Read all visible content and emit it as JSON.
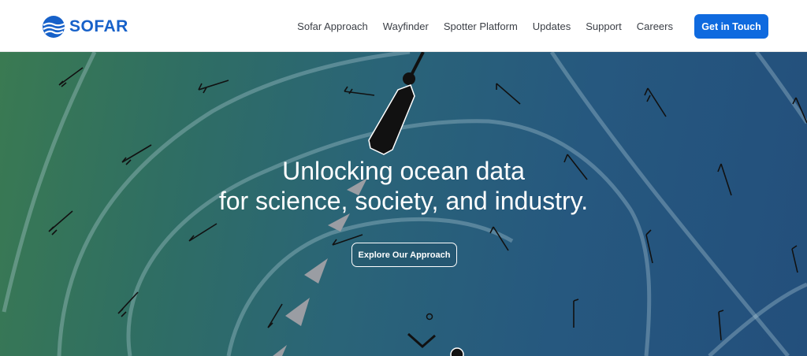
{
  "brand": {
    "name": "SOFAR",
    "color": "#1761c9"
  },
  "nav": {
    "items": [
      {
        "label": "Sofar Approach"
      },
      {
        "label": "Wayfinder"
      },
      {
        "label": "Spotter Platform"
      },
      {
        "label": "Updates"
      },
      {
        "label": "Support"
      },
      {
        "label": "Careers"
      }
    ],
    "cta_label": "Get in Touch",
    "cta_color": "#0f6adf"
  },
  "hero": {
    "headline_line1": "Unlocking ocean data",
    "headline_line2": "for science, society, and industry.",
    "button_label": "Explore Our Approach",
    "gradient_colors": [
      "#3a7a52",
      "#2a6478",
      "#234f7c"
    ],
    "icons": [
      "wind-barb-icon",
      "ship-icon",
      "route-arrow-icon",
      "waypoint-icon"
    ]
  }
}
